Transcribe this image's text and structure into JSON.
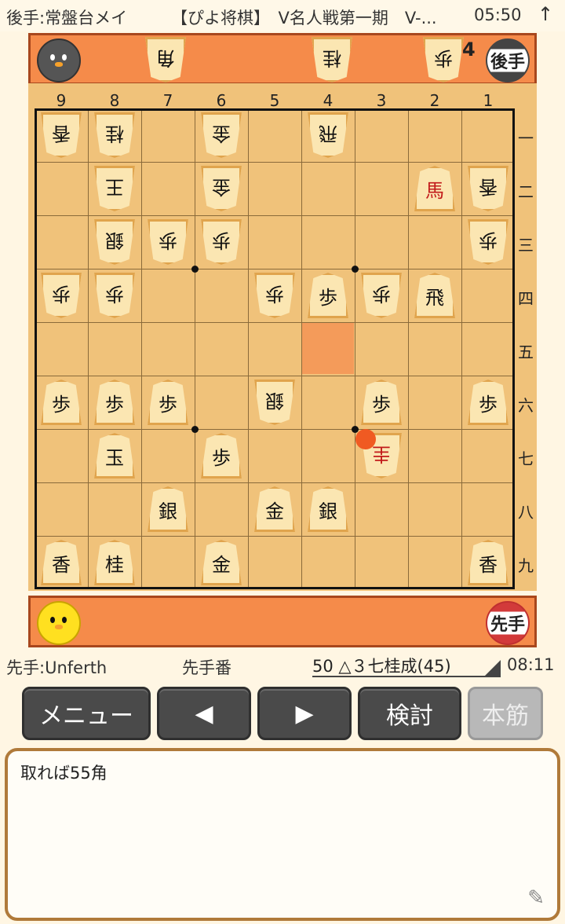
{
  "status_bar": {
    "gote_name": "後手:常盤台メイ",
    "event": "【ぴよ将棋】　V名人戦第一期　V-...",
    "time": "05:50",
    "arrow_icon": "up-arrow-icon"
  },
  "gote_stand": {
    "avatar_icon": "gray-chick-icon",
    "pieces": [
      {
        "label": "角",
        "count": ""
      },
      {
        "label": "桂",
        "count": ""
      },
      {
        "label": "歩",
        "count": "4"
      }
    ],
    "badge": "後手"
  },
  "sente_stand": {
    "avatar_icon": "yellow-chick-icon",
    "badge": "先手"
  },
  "board": {
    "files": [
      "9",
      "8",
      "7",
      "6",
      "5",
      "4",
      "3",
      "2",
      "1"
    ],
    "ranks": [
      "一",
      "二",
      "三",
      "四",
      "五",
      "六",
      "七",
      "八",
      "九"
    ],
    "last_move_square": "4五",
    "pieces": [
      {
        "sq": "9一",
        "label": "香",
        "side": "gote"
      },
      {
        "sq": "8一",
        "label": "桂",
        "side": "gote"
      },
      {
        "sq": "6一",
        "label": "金",
        "side": "gote"
      },
      {
        "sq": "4一",
        "label": "飛",
        "side": "gote"
      },
      {
        "sq": "8二",
        "label": "王",
        "side": "gote"
      },
      {
        "sq": "6二",
        "label": "金",
        "side": "gote"
      },
      {
        "sq": "2二",
        "label": "馬",
        "side": "sente",
        "promoted": true
      },
      {
        "sq": "1二",
        "label": "香",
        "side": "gote"
      },
      {
        "sq": "8三",
        "label": "銀",
        "side": "gote"
      },
      {
        "sq": "7三",
        "label": "歩",
        "side": "gote"
      },
      {
        "sq": "6三",
        "label": "歩",
        "side": "gote"
      },
      {
        "sq": "1三",
        "label": "歩",
        "side": "gote"
      },
      {
        "sq": "9四",
        "label": "歩",
        "side": "gote"
      },
      {
        "sq": "8四",
        "label": "歩",
        "side": "gote"
      },
      {
        "sq": "5四",
        "label": "歩",
        "side": "gote"
      },
      {
        "sq": "4四",
        "label": "歩",
        "side": "sente"
      },
      {
        "sq": "3四",
        "label": "歩",
        "side": "gote"
      },
      {
        "sq": "2四",
        "label": "飛",
        "side": "sente"
      },
      {
        "sq": "9六",
        "label": "歩",
        "side": "sente"
      },
      {
        "sq": "8六",
        "label": "歩",
        "side": "sente"
      },
      {
        "sq": "7六",
        "label": "歩",
        "side": "sente"
      },
      {
        "sq": "5六",
        "label": "銀",
        "side": "gote"
      },
      {
        "sq": "3六",
        "label": "歩",
        "side": "sente"
      },
      {
        "sq": "1六",
        "label": "歩",
        "side": "sente"
      },
      {
        "sq": "8七",
        "label": "玉",
        "side": "sente"
      },
      {
        "sq": "6七",
        "label": "歩",
        "side": "sente"
      },
      {
        "sq": "3七",
        "label": "圭",
        "side": "gote",
        "promoted": true
      },
      {
        "sq": "7八",
        "label": "銀",
        "side": "sente"
      },
      {
        "sq": "5八",
        "label": "金",
        "side": "sente"
      },
      {
        "sq": "4八",
        "label": "銀",
        "side": "sente"
      },
      {
        "sq": "9九",
        "label": "香",
        "side": "sente"
      },
      {
        "sq": "8九",
        "label": "桂",
        "side": "sente"
      },
      {
        "sq": "6九",
        "label": "金",
        "side": "sente"
      },
      {
        "sq": "1九",
        "label": "香",
        "side": "sente"
      }
    ]
  },
  "info_bar": {
    "sente_name": "先手:Unferth",
    "turn": "先手番",
    "move": "50 △３七桂成(45)",
    "clock": "08:11"
  },
  "buttons": {
    "menu": "メニュー",
    "prev": "◀",
    "next": "▶",
    "analyze": "検討",
    "main_line": "本筋"
  },
  "comment": {
    "text": "取れば55角",
    "edit_icon": "pencil-icon"
  },
  "colors": {
    "board": "#f0c27a",
    "stand": "#f58b4a",
    "last_move": "#f49b5a",
    "cursor": "#f05a22",
    "button": "#4a4a4a"
  }
}
